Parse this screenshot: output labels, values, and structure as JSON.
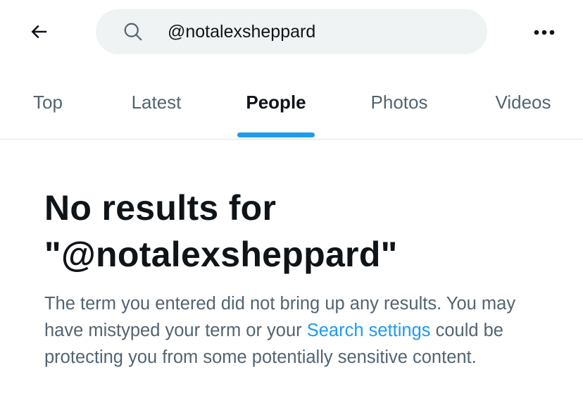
{
  "header": {
    "back_icon": "arrow-left-icon",
    "search": {
      "icon": "search-icon",
      "query": "@notalexsheppard"
    },
    "more_icon": "more-horizontal-icon"
  },
  "tabs": [
    {
      "label": "Top",
      "active": false
    },
    {
      "label": "Latest",
      "active": false
    },
    {
      "label": "People",
      "active": true
    },
    {
      "label": "Photos",
      "active": false
    },
    {
      "label": "Videos",
      "active": false
    }
  ],
  "empty_state": {
    "title_line1": "No results for",
    "title_line2": "\"@notalexsheppard\"",
    "body_before_link": "The term you entered did not bring up any results. You may have mistyped your term or your ",
    "link_label": "Search settings",
    "body_after_link": " could be protecting you from some potentially sensitive content."
  },
  "colors": {
    "accent": "#1d9bf0",
    "text_primary": "#0f1419",
    "text_secondary": "#536471",
    "search_bg": "#eff3f4"
  }
}
